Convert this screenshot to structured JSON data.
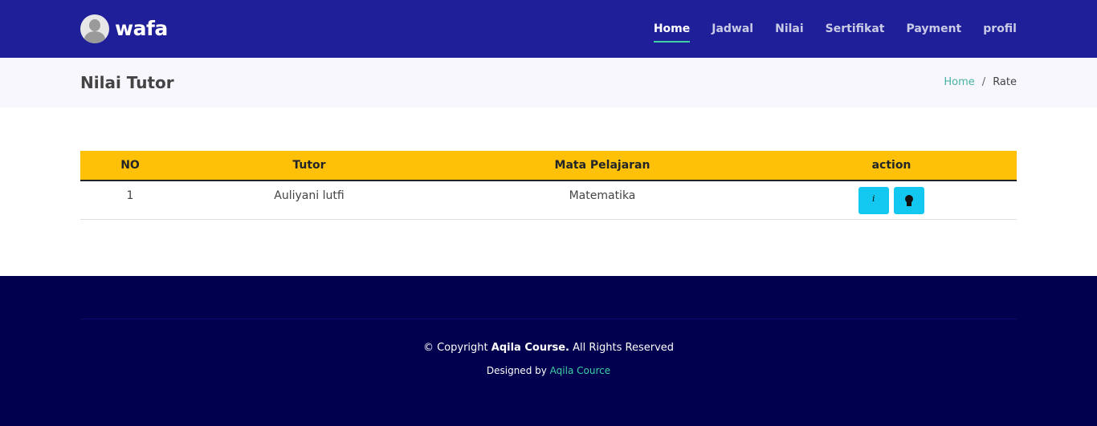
{
  "header": {
    "brand": "wafa",
    "nav": [
      {
        "label": "Home",
        "active": true
      },
      {
        "label": "Jadwal",
        "active": false
      },
      {
        "label": "Nilai",
        "active": false
      },
      {
        "label": "Sertifikat",
        "active": false
      },
      {
        "label": "Payment",
        "active": false
      },
      {
        "label": "profil",
        "active": false
      }
    ]
  },
  "breadcrumb_band": {
    "title": "Nilai Tutor",
    "crumbs": {
      "home": "Home",
      "separator": "/",
      "current": "Rate"
    }
  },
  "table": {
    "columns": [
      "NO",
      "Tutor",
      "Mata Pelajaran",
      "action"
    ],
    "rows": [
      {
        "no": "1",
        "tutor": "Auliyani lutfi",
        "mapel": "Matematika",
        "actions": [
          "info-icon",
          "award-icon"
        ]
      }
    ],
    "header_color": "#ffc107",
    "button_color": "#13c8f0"
  },
  "footer": {
    "copyright_prefix": "© Copyright",
    "copyright_brand": "Aqila Course.",
    "copyright_suffix": "All Rights Reserved",
    "designed_by": "Designed by",
    "designer": "Aqila Cource"
  },
  "colors": {
    "header_bg": "#1f1f99",
    "footer_bg": "#01004e",
    "accent": "#3fd1a3"
  }
}
